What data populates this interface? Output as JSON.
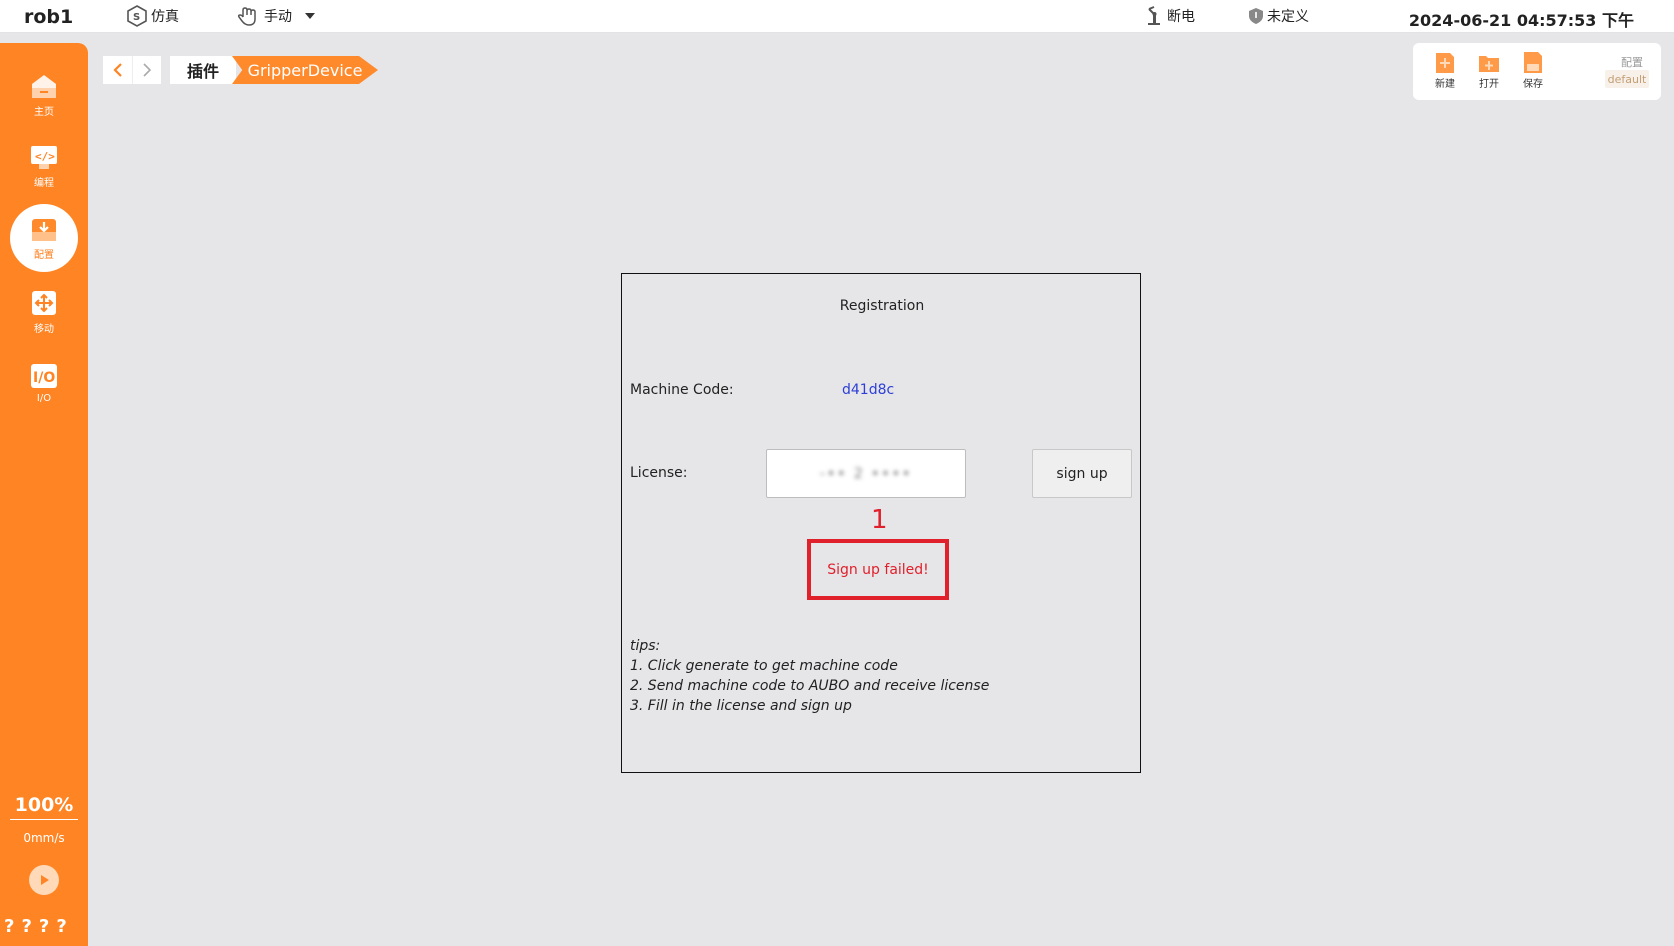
{
  "topbar": {
    "robot_name": "rob1",
    "mode": "仿真",
    "control": "手动",
    "power": "断电",
    "safety": "未定义",
    "datetime": "2024-06-21 04:57:53 下午"
  },
  "sidebar": {
    "items": [
      {
        "label": "主页",
        "icon": "home-icon"
      },
      {
        "label": "编程",
        "icon": "code-icon"
      },
      {
        "label": "配置",
        "icon": "config-icon"
      },
      {
        "label": "移动",
        "icon": "move-icon"
      },
      {
        "label": "I/O",
        "icon": "io-icon"
      }
    ],
    "active": "配置",
    "speed_percent": "100%",
    "speed_value": "0mm/s",
    "status": "????"
  },
  "breadcrumb": {
    "items": [
      "插件",
      "GripperDevice"
    ]
  },
  "toolbar": {
    "new_label": "新建",
    "open_label": "打开",
    "save_label": "保存",
    "config_label": "配置",
    "config_value": "default"
  },
  "dialog": {
    "title": "Registration",
    "machine_code_label": "Machine Code:",
    "machine_code_value": "d41d8c",
    "license_label": "License:",
    "license_value": "-•• 2 ••••",
    "signup_label": "sign up",
    "marker_number": "1",
    "error_message": "Sign up failed!",
    "tips": [
      "tips:",
      "1. Click generate to get machine code",
      "2. Send machine code to AUBO and receive license",
      "3. Fill in the license and sign up"
    ]
  },
  "colors": {
    "accent": "#ff8423",
    "error": "#e0202b",
    "link": "#2d3fd6"
  }
}
